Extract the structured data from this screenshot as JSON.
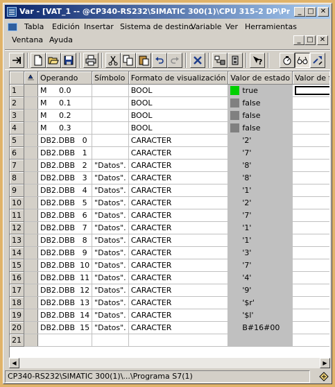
{
  "window": {
    "title": "Var - [VAT_1 -- @CP340-RS232\\SIMATIC 300(1)\\CPU 315-2 DP\\Pr...",
    "min_glyph": "_",
    "max_glyph": "□",
    "close_glyph": "✕"
  },
  "menu": {
    "items": [
      "Tabla",
      "Edición",
      "Insertar",
      "Sistema de destino",
      "Variable",
      "Ver",
      "Herramientas",
      "Ventana",
      "Ayuda"
    ]
  },
  "toolbar": {
    "icons": [
      "insert-row-icon",
      "new-icon",
      "open-icon",
      "save-icon",
      "print-icon",
      "cut-icon",
      "copy-icon",
      "paste-icon",
      "undo-icon",
      "redo-icon",
      "delete-icon",
      "monitor-online-icon",
      "plc-icon",
      "help-icon",
      "watch-variable-icon",
      "monitor-glasses-icon",
      "modify-variable-icon"
    ]
  },
  "table": {
    "columns": [
      "",
      "",
      "Operando",
      "Símbolo",
      "Formato de visualización",
      "Valor de estado",
      "Valor de forza"
    ],
    "rows": [
      {
        "n": "1",
        "operand": "M     0.0",
        "symbol": "",
        "format": "BOOL",
        "status": "true",
        "indicator": "green"
      },
      {
        "n": "2",
        "operand": "M     0.1",
        "symbol": "",
        "format": "BOOL",
        "status": "false",
        "indicator": "gray"
      },
      {
        "n": "3",
        "operand": "M     0.2",
        "symbol": "",
        "format": "BOOL",
        "status": "false",
        "indicator": "gray"
      },
      {
        "n": "4",
        "operand": "M     0.3",
        "symbol": "",
        "format": "BOOL",
        "status": "false",
        "indicator": "gray"
      },
      {
        "n": "5",
        "operand": "DB2.DBB   0",
        "symbol": "",
        "format": "CARACTER",
        "status": "'2'",
        "indicator": ""
      },
      {
        "n": "6",
        "operand": "DB2.DBB   1",
        "symbol": "",
        "format": "CARACTER",
        "status": "'7'",
        "indicator": ""
      },
      {
        "n": "7",
        "operand": "DB2.DBB   2",
        "symbol": "\"Datos\".",
        "format": "CARACTER",
        "status": "'8'",
        "indicator": ""
      },
      {
        "n": "8",
        "operand": "DB2.DBB   3",
        "symbol": "\"Datos\".",
        "format": "CARACTER",
        "status": "'8'",
        "indicator": ""
      },
      {
        "n": "9",
        "operand": "DB2.DBB   4",
        "symbol": "\"Datos\".",
        "format": "CARACTER",
        "status": "'1'",
        "indicator": ""
      },
      {
        "n": "10",
        "operand": "DB2.DBB   5",
        "symbol": "\"Datos\".",
        "format": "CARACTER",
        "status": "'2'",
        "indicator": ""
      },
      {
        "n": "11",
        "operand": "DB2.DBB   6",
        "symbol": "\"Datos\".",
        "format": "CARACTER",
        "status": "'7'",
        "indicator": ""
      },
      {
        "n": "12",
        "operand": "DB2.DBB   7",
        "symbol": "\"Datos\".",
        "format": "CARACTER",
        "status": "'1'",
        "indicator": ""
      },
      {
        "n": "13",
        "operand": "DB2.DBB   8",
        "symbol": "\"Datos\".",
        "format": "CARACTER",
        "status": "'1'",
        "indicator": ""
      },
      {
        "n": "14",
        "operand": "DB2.DBB   9",
        "symbol": "\"Datos\".",
        "format": "CARACTER",
        "status": "'3'",
        "indicator": ""
      },
      {
        "n": "15",
        "operand": "DB2.DBB  10",
        "symbol": "\"Datos\".",
        "format": "CARACTER",
        "status": "'7'",
        "indicator": ""
      },
      {
        "n": "16",
        "operand": "DB2.DBB  11",
        "symbol": "\"Datos\".",
        "format": "CARACTER",
        "status": "'4'",
        "indicator": ""
      },
      {
        "n": "17",
        "operand": "DB2.DBB  12",
        "symbol": "\"Datos\".",
        "format": "CARACTER",
        "status": "'9'",
        "indicator": ""
      },
      {
        "n": "18",
        "operand": "DB2.DBB  13",
        "symbol": "\"Datos\".",
        "format": "CARACTER",
        "status": "'$r'",
        "indicator": ""
      },
      {
        "n": "19",
        "operand": "DB2.DBB  14",
        "symbol": "\"Datos\".",
        "format": "CARACTER",
        "status": "'$l'",
        "indicator": ""
      },
      {
        "n": "20",
        "operand": "DB2.DBB  15",
        "symbol": "\"Datos\".",
        "format": "CARACTER",
        "status": "B#16#00",
        "indicator": ""
      },
      {
        "n": "21",
        "operand": "",
        "symbol": "",
        "format": "",
        "status": "",
        "indicator": ""
      }
    ]
  },
  "statusbar": {
    "path": "CP340-RS232\\SIMATIC 300(1)\\...\\Programa S7(1)"
  },
  "colors": {
    "title_start": "#0a246a",
    "title_end": "#a6caf0",
    "status_true": "#00d000",
    "status_false": "#808080",
    "outer_frame": "#e0b36a"
  }
}
